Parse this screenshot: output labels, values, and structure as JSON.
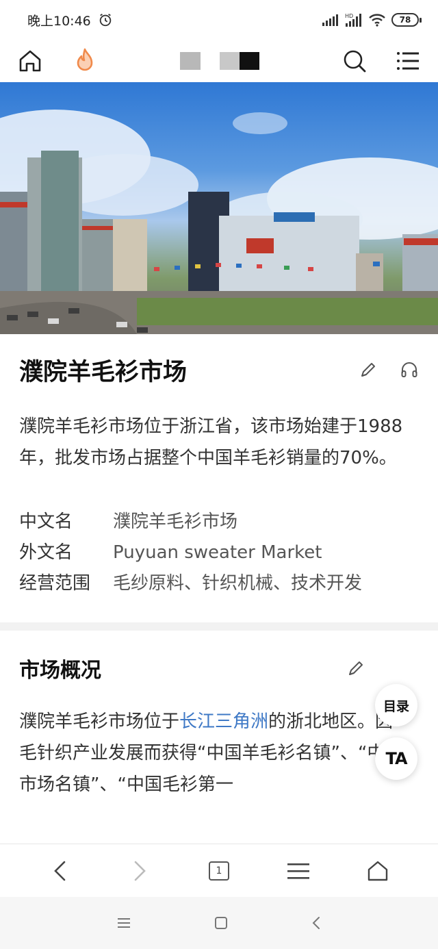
{
  "status_bar": {
    "time": "晚上10:46",
    "battery": "78",
    "icons": [
      "alarm-icon",
      "signal-icon",
      "hd-signal-icon",
      "wifi-icon",
      "battery-icon"
    ]
  },
  "top_nav": {
    "icons": [
      "home-icon",
      "hot-flame-icon",
      "search-icon",
      "menu-icon"
    ],
    "accent_flame": "#f08a4b"
  },
  "article": {
    "title": "濮院羊毛衫市场",
    "summary": "濮院羊毛衫市场位于浙江省，该市场始建于1988年，批发市场占据整个中国羊毛衫销量的70%。",
    "infobox": [
      {
        "key": "中文名",
        "value": "濮院羊毛衫市场"
      },
      {
        "key": "外文名",
        "value": "Puyuan sweater Market"
      },
      {
        "key": "经营范围",
        "value": "毛纱原料、针织机械、技术开发"
      }
    ],
    "section": {
      "title": "市场概况",
      "body_prefix": "濮院羊毛衫市场位于",
      "body_link": "长江三角洲",
      "body_suffix": "的浙北地区。因毛针织产业发展而获得“中国羊毛衫名镇”、“中国市场名镇”、“中国毛衫第一"
    }
  },
  "floating": {
    "toc_label": "目录",
    "ta_label": "TA"
  },
  "browser_bar": {
    "tab_count": "1"
  },
  "colors": {
    "link": "#3f79c6",
    "divider": "#f2f2f2"
  }
}
